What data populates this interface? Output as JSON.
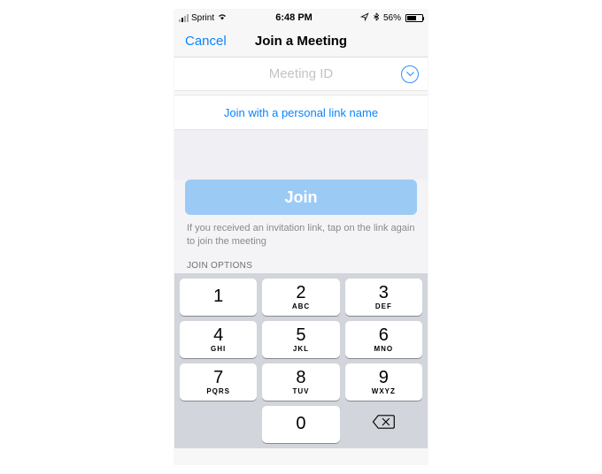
{
  "status": {
    "carrier": "Sprint",
    "time": "6:48 PM",
    "battery_pct": "56%"
  },
  "nav": {
    "cancel": "Cancel",
    "title": "Join a Meeting"
  },
  "meeting": {
    "placeholder": "Meeting ID",
    "personal_link": "Join with a personal link name",
    "join_label": "Join",
    "hint": "If you received an invitation link, tap on the link again to join the meeting",
    "section_header": "JOIN OPTIONS"
  },
  "keypad": [
    {
      "digit": "1",
      "letters": ""
    },
    {
      "digit": "2",
      "letters": "ABC"
    },
    {
      "digit": "3",
      "letters": "DEF"
    },
    {
      "digit": "4",
      "letters": "GHI"
    },
    {
      "digit": "5",
      "letters": "JKL"
    },
    {
      "digit": "6",
      "letters": "MNO"
    },
    {
      "digit": "7",
      "letters": "PQRS"
    },
    {
      "digit": "8",
      "letters": "TUV"
    },
    {
      "digit": "9",
      "letters": "WXYZ"
    },
    {
      "digit": "0",
      "letters": ""
    }
  ]
}
